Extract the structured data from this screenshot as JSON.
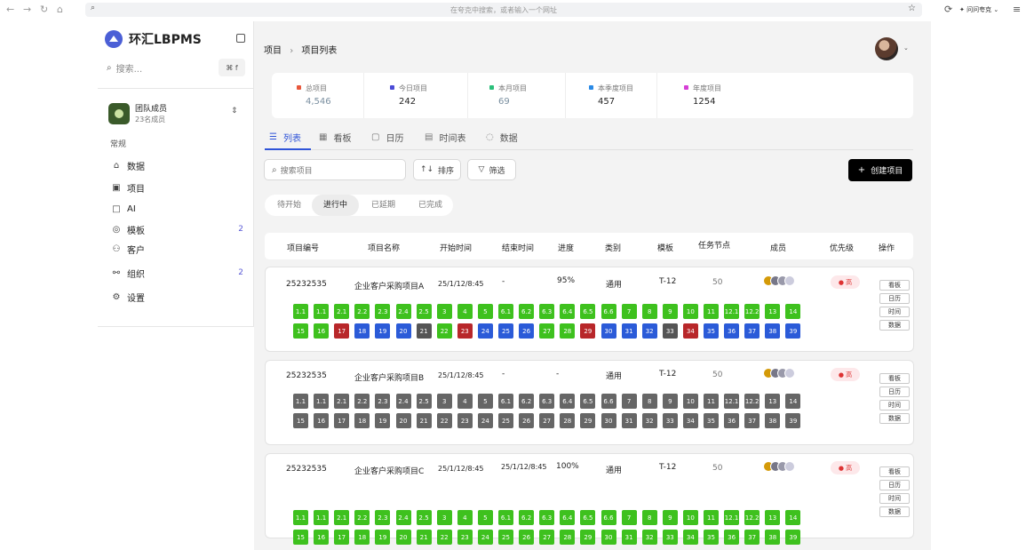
{
  "browser": {
    "address_placeholder": "在夸克中搜索，或者输入一个网址",
    "ask_label": "问问夸克"
  },
  "app": {
    "title": "环汇LBPMS"
  },
  "sidebar": {
    "search_label": "搜索...",
    "search_shortcut": "⌘ f",
    "team_name": "团队成员",
    "team_count": "23名成员",
    "section": "常规",
    "items": [
      {
        "label": "数据",
        "icon": "home-icon",
        "count": ""
      },
      {
        "label": "项目",
        "icon": "project-icon",
        "count": ""
      },
      {
        "label": "AI",
        "icon": "ai-icon",
        "count": ""
      },
      {
        "label": "模板",
        "icon": "template-icon",
        "count": "2"
      },
      {
        "label": "客户",
        "icon": "customer-icon",
        "count": ""
      },
      {
        "label": "组织",
        "icon": "org-icon",
        "count": "2"
      },
      {
        "label": "设置",
        "icon": "gear-icon",
        "count": ""
      }
    ]
  },
  "breadcrumb": {
    "root": "项目",
    "sep": "›",
    "current": "项目列表"
  },
  "stats": [
    {
      "label": "总项目",
      "value": "4,546",
      "color": "#e8573c"
    },
    {
      "label": "今日项目",
      "value": "242",
      "color": "#4b4bd6"
    },
    {
      "label": "本月项目",
      "value": "69",
      "color": "#2bbf7a"
    },
    {
      "label": "本季度项目",
      "value": "457",
      "color": "#2a8ae6"
    },
    {
      "label": "年度项目",
      "value": "1254",
      "color": "#d63fd6"
    }
  ],
  "tabs": [
    {
      "label": "列表"
    },
    {
      "label": "看板"
    },
    {
      "label": "日历"
    },
    {
      "label": "时间表"
    },
    {
      "label": "数据"
    }
  ],
  "toolbar": {
    "search_placeholder": "搜索项目",
    "sort_label": "排序",
    "filter_label": "筛选",
    "create_label": "创建项目"
  },
  "status_filter": [
    "待开始",
    "进行中",
    "已延期",
    "已完成"
  ],
  "columns": [
    "项目编号",
    "项目名称",
    "开始时间",
    "结束时间",
    "进度",
    "类别",
    "模板",
    "任务节点",
    "成员",
    "优先级",
    "操作"
  ],
  "projects": [
    {
      "id": "25232535",
      "name": "企业客户采购项目A",
      "start": "25/1/12/8:45",
      "end": "-",
      "progress": "95%",
      "category": "通用",
      "template": "T-12",
      "nodes_count": "50",
      "priority": "高"
    },
    {
      "id": "25232535",
      "name": "企业客户采购项目B",
      "start": "25/1/12/8:45",
      "end": "-",
      "progress": "-",
      "category": "通用",
      "template": "T-12",
      "nodes_count": "50",
      "priority": "高"
    },
    {
      "id": "25232535",
      "name": "企业客户采购项目C",
      "start": "25/1/12/8:45",
      "end": "25/1/12/8:45",
      "progress": "100%",
      "category": "通用",
      "template": "T-12",
      "nodes_count": "50",
      "priority": "高"
    }
  ],
  "op_labels": [
    "看板",
    "日历",
    "时间",
    "数据"
  ],
  "node_labels": [
    "1.1",
    "1.1",
    "2.1",
    "2.2",
    "2.3",
    "2.4",
    "2.5",
    "3",
    "4",
    "5",
    "6.1",
    "6.2",
    "6.3",
    "6.4",
    "6.5",
    "6.6",
    "7",
    "8",
    "9",
    "10",
    "11",
    "12.1",
    "12.2",
    "13",
    "14",
    "15",
    "16",
    "17",
    "18",
    "19",
    "20",
    "21",
    "22",
    "23",
    "24",
    "25",
    "26",
    "27",
    "28",
    "29",
    "30",
    "31",
    "32",
    "33",
    "34",
    "35",
    "36",
    "37",
    "38",
    "39"
  ],
  "node_status": {
    "A": [
      "g",
      "g",
      "g",
      "g",
      "g",
      "g",
      "g",
      "g",
      "g",
      "g",
      "g",
      "g",
      "g",
      "g",
      "g",
      "g",
      "g",
      "g",
      "g",
      "g",
      "g",
      "g",
      "g",
      "g",
      "g",
      "g",
      "g",
      "r",
      "b",
      "b",
      "b",
      "d",
      "g",
      "r",
      "b",
      "b",
      "b",
      "g",
      "g",
      "r",
      "b",
      "b",
      "b",
      "d",
      "r",
      "b",
      "b",
      "b",
      "b",
      "b"
    ],
    "B": [
      "gr",
      "gr",
      "gr",
      "gr",
      "gr",
      "gr",
      "gr",
      "gr",
      "gr",
      "gr",
      "gr",
      "gr",
      "gr",
      "gr",
      "gr",
      "gr",
      "gr",
      "gr",
      "gr",
      "gr",
      "gr",
      "gr",
      "gr",
      "gr",
      "gr",
      "gr",
      "gr",
      "gr",
      "gr",
      "gr",
      "gr",
      "gr",
      "gr",
      "gr",
      "gr",
      "gr",
      "gr",
      "gr",
      "gr",
      "gr",
      "gr",
      "gr",
      "gr",
      "gr",
      "gr",
      "gr",
      "gr",
      "gr",
      "gr",
      "gr"
    ],
    "C": [
      "g",
      "g",
      "g",
      "g",
      "g",
      "g",
      "g",
      "g",
      "g",
      "g",
      "g",
      "g",
      "g",
      "g",
      "g",
      "g",
      "g",
      "g",
      "g",
      "g",
      "g",
      "g",
      "g",
      "g",
      "g",
      "g",
      "g",
      "g",
      "g",
      "g",
      "g",
      "g",
      "g",
      "g",
      "g",
      "g",
      "g",
      "g",
      "g",
      "g",
      "g",
      "g",
      "g",
      "g",
      "g",
      "g",
      "g",
      "g",
      "g",
      "g"
    ]
  }
}
